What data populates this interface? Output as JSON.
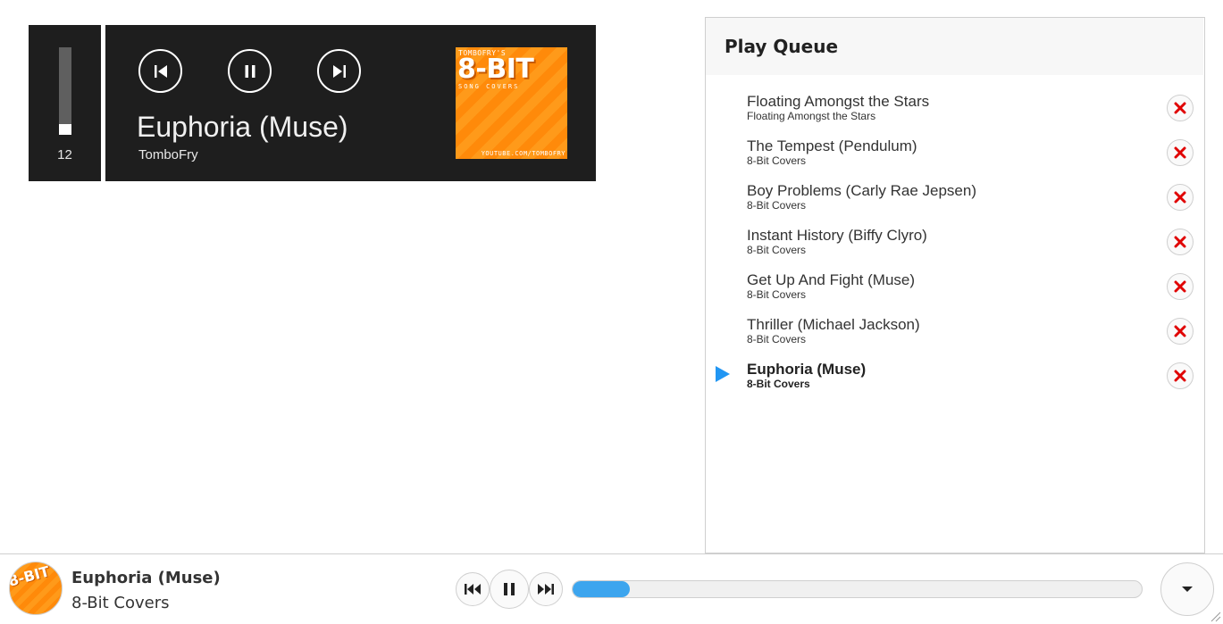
{
  "player": {
    "volume_value": "12",
    "volume_fraction": 0.12,
    "now_playing_title": "Euphoria (Muse)",
    "now_playing_artist": "TomboFry",
    "album_art": {
      "header": "TOMBOFRY'S",
      "title": "8-BIT",
      "subtitle": "SONG COVERS",
      "footer": "YOUTUBE.COM/TOMBOFRY"
    },
    "controls": [
      "previous-icon",
      "pause-icon",
      "next-icon"
    ]
  },
  "queue": {
    "title": "Play Queue",
    "items": [
      {
        "title": "Floating Amongst the Stars",
        "subtitle": "Floating Amongst the Stars",
        "active": false
      },
      {
        "title": "The Tempest (Pendulum)",
        "subtitle": "8-Bit Covers",
        "active": false
      },
      {
        "title": "Boy Problems (Carly Rae Jepsen)",
        "subtitle": "8-Bit Covers",
        "active": false
      },
      {
        "title": "Instant History (Biffy Clyro)",
        "subtitle": "8-Bit Covers",
        "active": false
      },
      {
        "title": "Get Up And Fight (Muse)",
        "subtitle": "8-Bit Covers",
        "active": false
      },
      {
        "title": "Thriller (Michael Jackson)",
        "subtitle": "8-Bit Covers",
        "active": false
      },
      {
        "title": "Euphoria (Muse)",
        "subtitle": "8-Bit Covers",
        "active": true
      }
    ],
    "active_indicator_color": "#2196f3",
    "remove_icon_color": "#e00000"
  },
  "bottom_bar": {
    "title": "Euphoria (Muse)",
    "subtitle": "8-Bit Covers",
    "avatar_text": "8-BIT",
    "progress_fraction": 0.1,
    "progress_color": "#3da5ee"
  }
}
